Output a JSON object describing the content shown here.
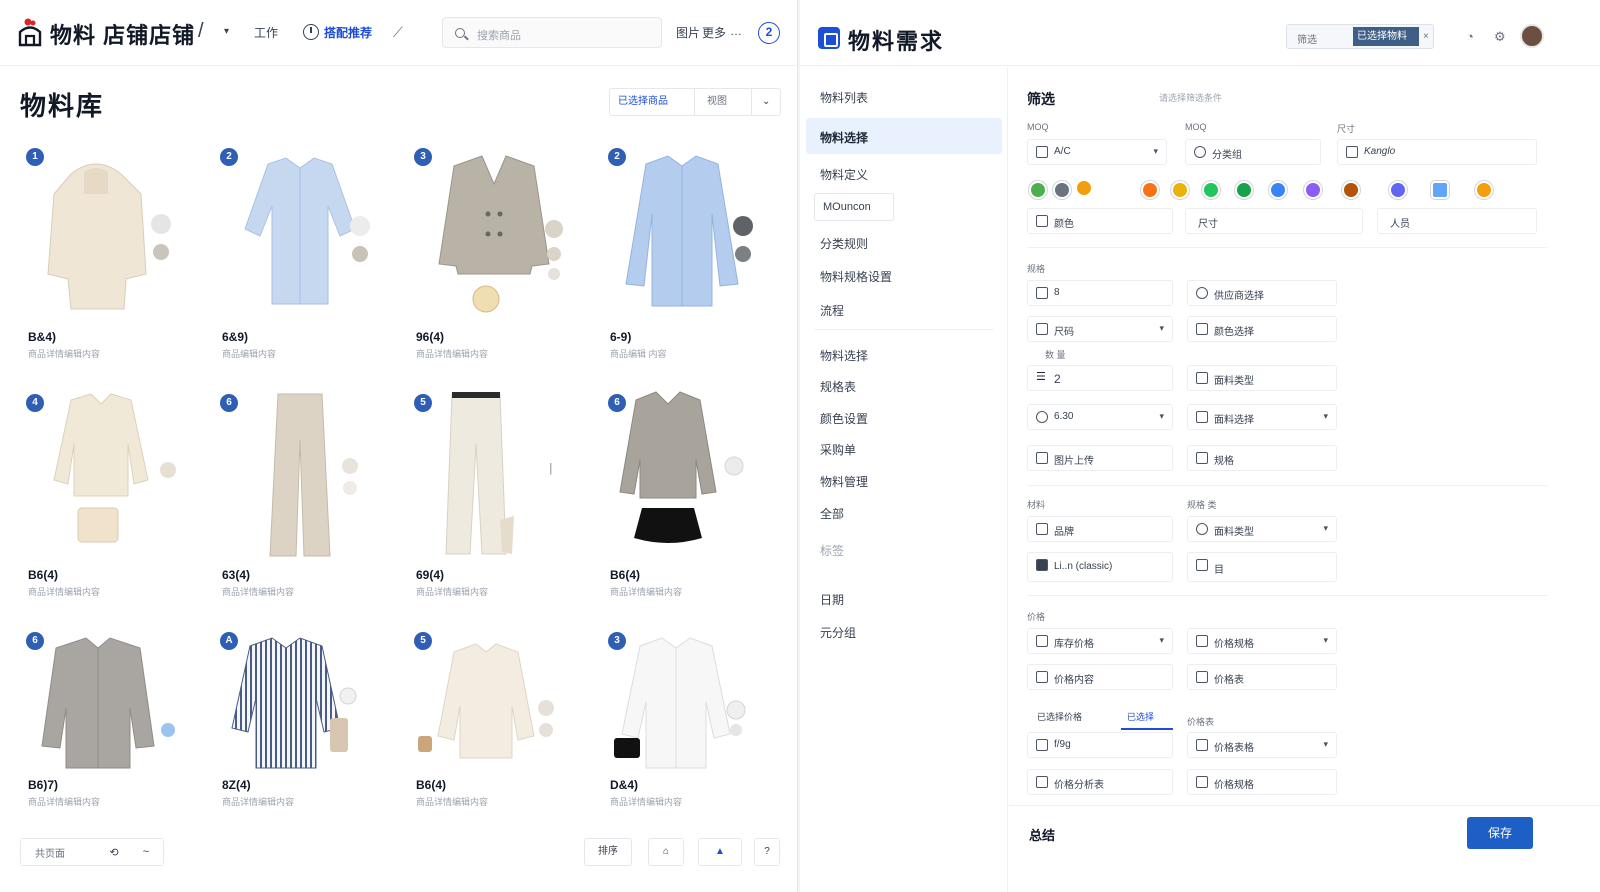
{
  "left_app": {
    "title": "物料 店铺店铺",
    "slash": "/",
    "nav": [
      {
        "label": "工作"
      },
      {
        "label": "搭配推荐"
      }
    ],
    "search_placeholder": "搜索商品",
    "toolbar_right": [
      "图片",
      "更多",
      "…"
    ],
    "help": "2",
    "page_title": "物料库",
    "view_switch": {
      "active": "已选择商品",
      "other": "视图",
      "caret": "⌄"
    },
    "products": [
      {
        "badge": "1",
        "name": "B&4)",
        "sub": "商品详情编辑内容"
      },
      {
        "badge": "2",
        "name": "6&9)",
        "sub": "商品编辑内容"
      },
      {
        "badge": "3",
        "name": "96(4)",
        "sub": "商品详情编辑内容"
      },
      {
        "badge": "2",
        "name": "6-9)",
        "sub": "商品编辑 内容"
      },
      {
        "badge": "4",
        "name": "B6(4)",
        "sub": "商品详情编辑内容"
      },
      {
        "badge": "6",
        "name": "63(4)",
        "sub": "商品详情编辑内容"
      },
      {
        "badge": "5",
        "name": "69(4)",
        "sub": "商品详情编辑内容"
      },
      {
        "badge": "6",
        "name": "B6(4)",
        "sub": "商品详情编辑内容"
      },
      {
        "badge": "6",
        "name": "B6)7)",
        "sub": "商品详情编辑内容"
      },
      {
        "badge": "A",
        "name": "8Z(4)",
        "sub": "商品详情编辑内容"
      },
      {
        "badge": "5",
        "name": "B6(4)",
        "sub": "商品详情编辑内容"
      },
      {
        "badge": "3",
        "name": "D&4)",
        "sub": "商品详情编辑内容"
      }
    ],
    "footer": {
      "page_label": "共页面",
      "prev": "⟲",
      "next": "~",
      "sort": "排序",
      "share": "⌂",
      "user": "▲",
      "more": "?"
    }
  },
  "right_app": {
    "title": "物料需求",
    "pill_left": "筛选",
    "pill_active": "已选择物料",
    "icons": [
      "bell-icon",
      "settings-icon"
    ],
    "sidebar": [
      {
        "label": "物料列表"
      },
      {
        "label": "物料选择"
      },
      {
        "label": "物料定义"
      },
      {
        "label": "MOuncon"
      },
      {
        "label": "分类规则"
      },
      {
        "label": "物料规格设置"
      },
      {
        "label": "流程"
      },
      {
        "label": "物料选择"
      },
      {
        "label": "规格表"
      },
      {
        "label": "颜色设置"
      },
      {
        "label": "采购单"
      },
      {
        "label": "物料管理"
      },
      {
        "label": "全部"
      },
      {
        "label": "标签"
      },
      {
        "label": "日期"
      },
      {
        "label": "元分组"
      }
    ],
    "form": {
      "section_title": "筛选",
      "section_hint": "请选择筛选条件",
      "labels": {
        "moq1": "MOQ",
        "moq2": "MOQ",
        "other": "尺寸"
      },
      "row1": [
        {
          "text": "A/C",
          "dd": "▾"
        },
        {
          "text": "分类组"
        },
        {
          "text": "Kanglo"
        }
      ],
      "row2": [
        {
          "text": "颜色"
        },
        {
          "text": "尺寸"
        },
        {
          "text": "人员"
        }
      ],
      "section2_label": "规格",
      "pairs": [
        {
          "left": {
            "text": "8"
          },
          "right": {
            "text": "供应商选择"
          }
        },
        {
          "left": {
            "text": "尺码",
            "dd": "▾"
          },
          "right": {
            "text": "颜色选择"
          }
        },
        {
          "left": {
            "text": "2"
          },
          "right": {
            "text": "面料类型"
          }
        },
        {
          "left": {
            "text": "6.30",
            "dd": "▾"
          },
          "right": {
            "text": "面料选择",
            "dd": "▾"
          }
        },
        {
          "left": {
            "text": "图片上传"
          },
          "right": {
            "text": "规格"
          }
        }
      ],
      "sub_label": "数 量",
      "section3_left": "材料",
      "section3_right": "规格 类",
      "pairs3": [
        {
          "left": {
            "text": "品牌"
          },
          "right": {
            "text": "面料类型",
            "dd": "▾"
          }
        },
        {
          "left": {
            "text": "Li..n (classic)"
          },
          "right": {
            "text": "目"
          }
        }
      ],
      "section4_label": "价格",
      "pairs4": [
        {
          "left": {
            "text": "库存价格",
            "dd": "▾"
          },
          "right": {
            "text": "价格规格",
            "dd": "▾"
          }
        },
        {
          "left": {
            "text": "价格内容"
          },
          "right": {
            "text": "价格表"
          }
        }
      ],
      "tabs": {
        "a": "已选择价格",
        "b": "已选择"
      },
      "tab_side_label": "价格表",
      "pairs5": [
        {
          "left": {
            "text": "f/9g"
          },
          "right": {
            "text": "价格表格",
            "dd": "▾"
          }
        },
        {
          "left": {
            "text": "价格分析表"
          },
          "right": {
            "text": "价格规格"
          }
        }
      ],
      "summary": "总结",
      "save": "保存"
    },
    "swatch_colors": [
      "#4caf50",
      "#6b7280",
      "#f59e0b",
      "#f97316",
      "#eab308",
      "#22c55e",
      "#16a34a",
      "#3b82f6",
      "#8b5cf6",
      "#b45309",
      "#6366f1",
      "#60a5fa",
      "#f59e0b"
    ]
  }
}
